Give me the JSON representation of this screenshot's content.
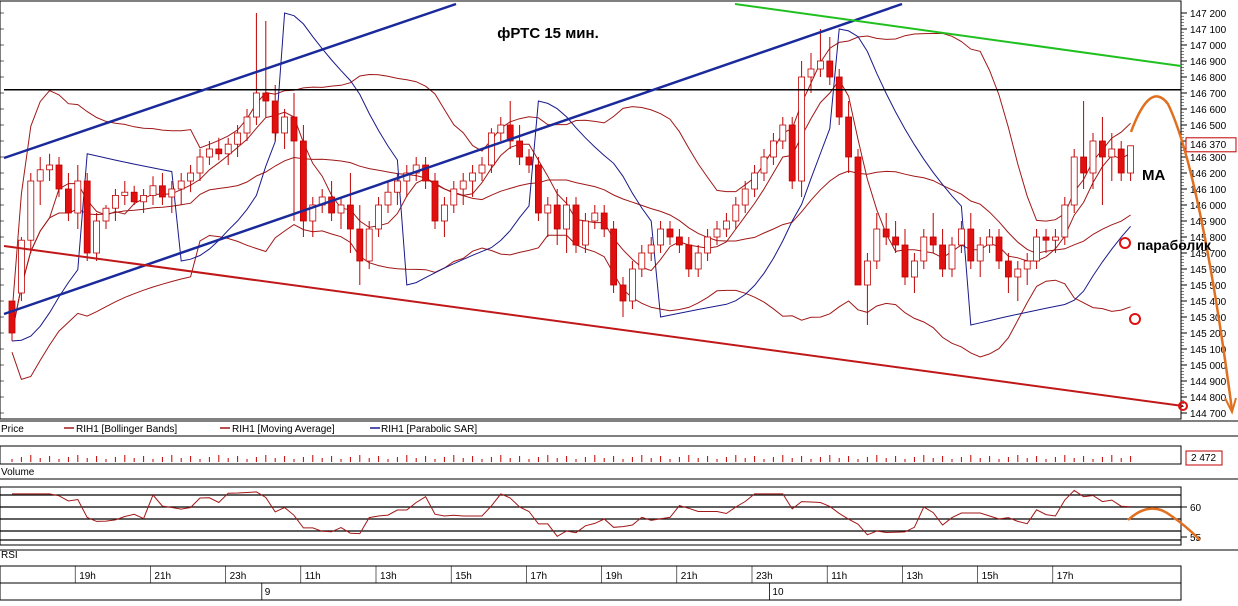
{
  "chart_data": {
    "type": "candlestick",
    "title": "фРТС   15 мин.",
    "colors": {
      "bull": "#ffffff",
      "bear": "#e01010",
      "candle_outline": "#c00000",
      "bollinger": "#a01818",
      "moving_average": "#a01818",
      "parabolic_sar": "#1a1a8c",
      "annotation": "#e07020",
      "upper_channel": "#1a2a9a",
      "lower_channel": "#c01818",
      "green_line": "#20c020",
      "horizontal_level": "#000000"
    },
    "price_axis": {
      "ylim": [
        144700,
        147240
      ],
      "ticks": [
        "147 200",
        "147 100",
        "147 000",
        "146 900",
        "146 800",
        "146 700",
        "146 600",
        "146 500",
        "146 400",
        "146 300",
        "146 200",
        "146 100",
        "146 000",
        "145 900",
        "145 800",
        "145 700",
        "145 600",
        "145 500",
        "145 400",
        "145 300",
        "145 200",
        "145 100",
        "145 000",
        "144 900",
        "144 800",
        "144 700"
      ],
      "tick_values": [
        147200,
        147100,
        147000,
        146900,
        146800,
        146700,
        146600,
        146500,
        146400,
        146300,
        146200,
        146100,
        146000,
        145900,
        145800,
        145700,
        145600,
        145500,
        145400,
        145300,
        145200,
        145100,
        145000,
        144900,
        144800,
        144700
      ],
      "last_price_label": "146 370",
      "last_price": 146370
    },
    "legend": [
      {
        "label": "Price"
      },
      {
        "label": "RIH1 [Bollinger Bands]"
      },
      {
        "label": "RIH1 [Moving Average]"
      },
      {
        "label": "RIH1 [Parabolic SAR]"
      }
    ],
    "volume": {
      "label": "Volume",
      "last_value": "2 472"
    },
    "rsi": {
      "label": "RSI",
      "ticks": [
        "60",
        "55"
      ],
      "tick_values": [
        60,
        55
      ],
      "levels": [
        62,
        60,
        58,
        56,
        54.5
      ],
      "ylim": [
        54,
        63
      ]
    },
    "time_axis": {
      "hour_labels": [
        "19h",
        "21h",
        "23h",
        "11h",
        "13h",
        "15h",
        "17h",
        "19h",
        "21h",
        "23h",
        "11h",
        "13h",
        "15h",
        "17h"
      ],
      "hour_positions": [
        8,
        16,
        24,
        32,
        40,
        48,
        56,
        64,
        72,
        80,
        88,
        96,
        104,
        112
      ],
      "day_labels": [
        "9",
        "10"
      ],
      "day_positions": [
        27,
        81
      ]
    },
    "annotations": {
      "ma": "MA",
      "parabolic": "параболик"
    },
    "horizontal_level": 146720,
    "candles": [
      [
        145400,
        145400,
        145150,
        145200
      ],
      [
        145450,
        145800,
        145400,
        145780
      ],
      [
        145780,
        146200,
        145700,
        146150
      ],
      [
        146150,
        146300,
        146000,
        146220
      ],
      [
        146220,
        146320,
        146150,
        146250
      ],
      [
        146250,
        146300,
        146050,
        146100
      ],
      [
        146100,
        146200,
        145900,
        145950
      ],
      [
        145950,
        146250,
        145850,
        146150
      ],
      [
        146150,
        146200,
        145650,
        145700
      ],
      [
        145700,
        145950,
        145650,
        145900
      ],
      [
        145900,
        146000,
        145850,
        145980
      ],
      [
        145980,
        146100,
        145900,
        146060
      ],
      [
        146060,
        146150,
        146000,
        146080
      ],
      [
        146080,
        146120,
        146000,
        146020
      ],
      [
        146020,
        146100,
        145950,
        146060
      ],
      [
        146060,
        146180,
        146000,
        146120
      ],
      [
        146120,
        146200,
        146000,
        146050
      ],
      [
        146050,
        146150,
        145950,
        146100
      ],
      [
        146100,
        146200,
        146000,
        146150
      ],
      [
        146150,
        146250,
        146080,
        146200
      ],
      [
        146200,
        146350,
        146150,
        146300
      ],
      [
        146300,
        146400,
        146250,
        146350
      ],
      [
        146350,
        146420,
        146280,
        146320
      ],
      [
        146320,
        146420,
        146250,
        146380
      ],
      [
        146380,
        146500,
        146300,
        146450
      ],
      [
        146450,
        146600,
        146400,
        146550
      ],
      [
        146550,
        147200,
        146500,
        146700
      ],
      [
        146700,
        147150,
        146550,
        146650
      ],
      [
        146650,
        146750,
        146400,
        146450
      ],
      [
        146450,
        146600,
        146350,
        146550
      ],
      [
        146550,
        146700,
        145900,
        146400
      ],
      [
        146400,
        146500,
        145800,
        145900
      ],
      [
        145900,
        146050,
        145800,
        146000
      ],
      [
        146000,
        146100,
        145950,
        146050
      ],
      [
        146050,
        146150,
        145900,
        145950
      ],
      [
        145950,
        146050,
        145850,
        146000
      ],
      [
        146000,
        146200,
        145700,
        145850
      ],
      [
        145850,
        146000,
        145500,
        145650
      ],
      [
        145650,
        145900,
        145600,
        145850
      ],
      [
        145850,
        146050,
        145800,
        146000
      ],
      [
        146000,
        146150,
        145950,
        146080
      ],
      [
        146080,
        146200,
        146000,
        146150
      ],
      [
        146150,
        146250,
        146050,
        146200
      ],
      [
        146200,
        146300,
        146150,
        146250
      ],
      [
        146250,
        146300,
        146100,
        146150
      ],
      [
        146150,
        146200,
        145850,
        145900
      ],
      [
        145900,
        146050,
        145800,
        146000
      ],
      [
        146000,
        146150,
        145950,
        146100
      ],
      [
        146100,
        146200,
        146000,
        146150
      ],
      [
        146150,
        146250,
        146050,
        146200
      ],
      [
        146200,
        146300,
        146150,
        146250
      ],
      [
        146250,
        146480,
        146200,
        146450
      ],
      [
        146450,
        146550,
        146400,
        146500
      ],
      [
        146500,
        146650,
        146350,
        146400
      ],
      [
        146400,
        146500,
        146250,
        146300
      ],
      [
        146300,
        146350,
        146200,
        146250
      ],
      [
        146250,
        146300,
        145900,
        145950
      ],
      [
        145950,
        146050,
        145800,
        146000
      ],
      [
        146000,
        146100,
        145750,
        145850
      ],
      [
        145850,
        146050,
        145700,
        146000
      ],
      [
        146000,
        146050,
        145700,
        145750
      ],
      [
        145750,
        145950,
        145700,
        145900
      ],
      [
        145900,
        146000,
        145850,
        145950
      ],
      [
        145950,
        146000,
        145800,
        145850
      ],
      [
        145850,
        145900,
        145450,
        145500
      ],
      [
        145500,
        145550,
        145300,
        145400
      ],
      [
        145400,
        145650,
        145350,
        145600
      ],
      [
        145600,
        145750,
        145550,
        145700
      ],
      [
        145700,
        145800,
        145650,
        145750
      ],
      [
        145750,
        145900,
        145700,
        145850
      ],
      [
        145850,
        145900,
        145750,
        145800
      ],
      [
        145800,
        145850,
        145700,
        145750
      ],
      [
        145750,
        145800,
        145550,
        145600
      ],
      [
        145600,
        145750,
        145550,
        145700
      ],
      [
        145700,
        145850,
        145650,
        145800
      ],
      [
        145800,
        145900,
        145750,
        145850
      ],
      [
        145850,
        145950,
        145800,
        145900
      ],
      [
        145900,
        146050,
        145850,
        146000
      ],
      [
        146000,
        146150,
        145950,
        146100
      ],
      [
        146100,
        146250,
        146050,
        146200
      ],
      [
        146200,
        146350,
        146150,
        146300
      ],
      [
        146300,
        146450,
        146250,
        146400
      ],
      [
        146400,
        146550,
        146350,
        146500
      ],
      [
        146500,
        146550,
        146100,
        146150
      ],
      [
        146150,
        146900,
        146050,
        146800
      ],
      [
        146800,
        146950,
        146700,
        146850
      ],
      [
        146850,
        147100,
        146800,
        146900
      ],
      [
        146900,
        147050,
        146750,
        146800
      ],
      [
        146800,
        146850,
        146500,
        146550
      ],
      [
        146550,
        146650,
        146200,
        146300
      ],
      [
        146300,
        146350,
        145500,
        145500
      ],
      [
        145500,
        145700,
        145250,
        145650
      ],
      [
        145650,
        145950,
        145600,
        145850
      ],
      [
        145850,
        145950,
        145750,
        145800
      ],
      [
        145800,
        145900,
        145700,
        145750
      ],
      [
        145750,
        145850,
        145500,
        145550
      ],
      [
        145550,
        145700,
        145450,
        145650
      ],
      [
        145650,
        145850,
        145600,
        145800
      ],
      [
        145800,
        145950,
        145700,
        145750
      ],
      [
        145750,
        145850,
        145550,
        145600
      ],
      [
        145600,
        145800,
        145550,
        145750
      ],
      [
        145750,
        145900,
        145700,
        145850
      ],
      [
        145850,
        145950,
        145600,
        145650
      ],
      [
        145650,
        145800,
        145550,
        145750
      ],
      [
        145750,
        145850,
        145700,
        145800
      ],
      [
        145800,
        145850,
        145600,
        145650
      ],
      [
        145650,
        145700,
        145450,
        145550
      ],
      [
        145550,
        145650,
        145400,
        145600
      ],
      [
        145600,
        145700,
        145500,
        145650
      ],
      [
        145650,
        145850,
        145600,
        145800
      ],
      [
        145800,
        145850,
        145700,
        145780
      ],
      [
        145780,
        145850,
        145700,
        145800
      ],
      [
        145800,
        146050,
        145750,
        146000
      ],
      [
        146000,
        146350,
        145950,
        146300
      ],
      [
        146300,
        146650,
        146100,
        146200
      ],
      [
        146200,
        146450,
        146100,
        146400
      ],
      [
        146400,
        146550,
        146000,
        146300
      ],
      [
        146300,
        146450,
        146150,
        146350
      ],
      [
        146350,
        146400,
        146150,
        146200
      ],
      [
        146200,
        146370,
        146150,
        146370
      ]
    ]
  }
}
